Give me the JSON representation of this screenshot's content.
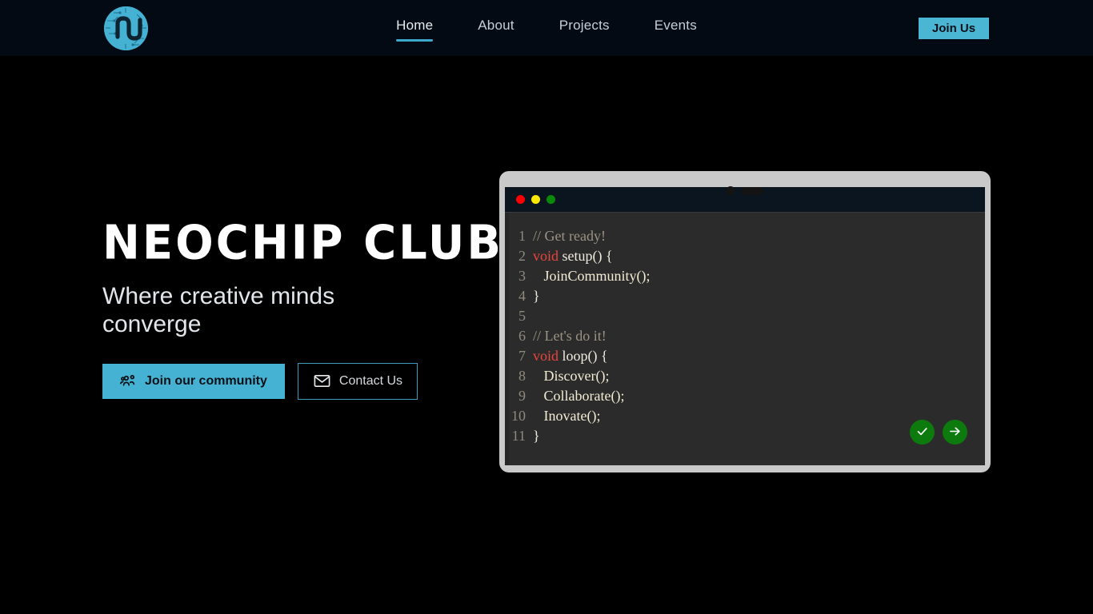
{
  "brand": {
    "logo_icon": "neochip-circuit-logo",
    "name": "NeoChip Club"
  },
  "header": {
    "nav_items": [
      {
        "label": "Home",
        "active": true
      },
      {
        "label": "About",
        "active": false
      },
      {
        "label": "Projects",
        "active": false
      },
      {
        "label": "Events",
        "active": false
      }
    ],
    "join_us_label": "Join Us",
    "accent_color": "#45b2d3",
    "background_color": "#040a14"
  },
  "hero": {
    "title": "NEOCHIP CLUB",
    "subtitle": "Where creative minds converge",
    "primary_cta": {
      "label": "Join our community",
      "icon": "people-group-icon",
      "background_color": "#45b2d3",
      "text_color": "#0a1016"
    },
    "secondary_cta": {
      "label": "Contact Us",
      "icon": "envelope-icon",
      "border_color": "#3e9dbe",
      "text_color": "#d6dade"
    }
  },
  "editor": {
    "frame_color": "#c9c9c9",
    "titlebar_color": "#0b1520",
    "background_color": "#2b2b2b",
    "window_dots": [
      {
        "name": "close",
        "color": "#fe0000"
      },
      {
        "name": "minimize",
        "color": "#ffe900"
      },
      {
        "name": "maximize",
        "color": "#0a8a0a"
      }
    ],
    "notch": {
      "camera_icon": "camera-dot",
      "speaker_icon": "speaker-pill"
    },
    "lines": [
      {
        "no": "1",
        "segments": [
          {
            "text": "// Get ready!",
            "cls": "tok-comment"
          }
        ]
      },
      {
        "no": "2",
        "segments": [
          {
            "text": "void",
            "cls": "tok-kw"
          },
          {
            "text": " setup() {",
            "cls": "tok-plain"
          }
        ]
      },
      {
        "no": "3",
        "segments": [
          {
            "text": "   JoinCommunity();",
            "cls": "tok-fn"
          }
        ]
      },
      {
        "no": "4",
        "segments": [
          {
            "text": "}",
            "cls": "tok-plain"
          }
        ]
      },
      {
        "no": "5",
        "segments": [
          {
            "text": "",
            "cls": "tok-plain"
          }
        ]
      },
      {
        "no": "6",
        "segments": [
          {
            "text": "// Let's do it!",
            "cls": "tok-comment"
          }
        ]
      },
      {
        "no": "7",
        "segments": [
          {
            "text": "void",
            "cls": "tok-kw"
          },
          {
            "text": " loop() {",
            "cls": "tok-plain"
          }
        ]
      },
      {
        "no": "8",
        "segments": [
          {
            "text": "   Discover();",
            "cls": "tok-fn"
          }
        ]
      },
      {
        "no": "9",
        "segments": [
          {
            "text": "   Collaborate();",
            "cls": "tok-fn"
          }
        ]
      },
      {
        "no": "10",
        "segments": [
          {
            "text": "   Inovate();",
            "cls": "tok-fn"
          }
        ]
      },
      {
        "no": "11",
        "segments": [
          {
            "text": "}",
            "cls": "tok-plain"
          }
        ]
      }
    ],
    "action_buttons": [
      {
        "name": "verify-button",
        "icon": "check-icon",
        "color": "#0d7a0d"
      },
      {
        "name": "upload-button",
        "icon": "arrow-right-icon",
        "color": "#0d7a0d"
      }
    ]
  }
}
